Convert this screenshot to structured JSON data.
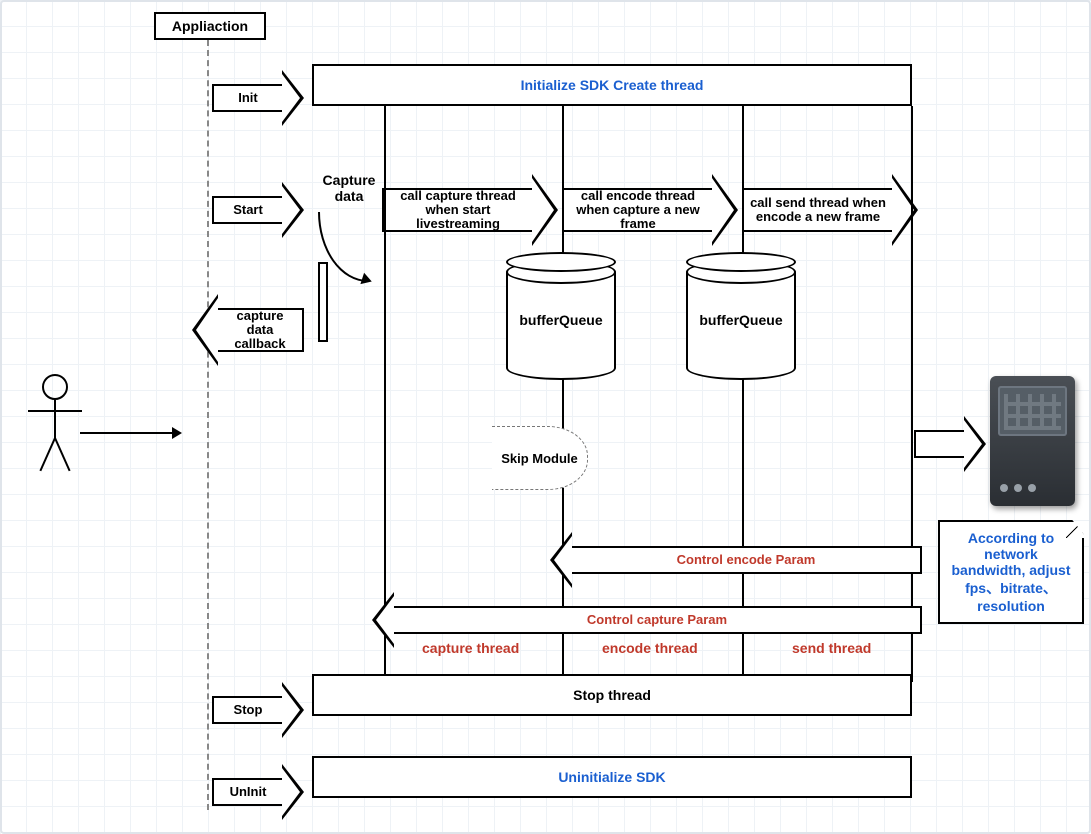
{
  "header": {
    "application": "Appliaction"
  },
  "lifecycle": {
    "init": {
      "label": "Init",
      "bar": "Initialize SDK     Create thread"
    },
    "start": {
      "label": "Start"
    },
    "stop": {
      "label": "Stop",
      "bar": "Stop thread"
    },
    "uninit": {
      "label": "UnInit",
      "bar": "Uninitialize SDK"
    }
  },
  "capture": {
    "data_label": "Capture data",
    "callback_label": "capture data callback"
  },
  "pipeline": {
    "step1": "call capture thread when start livestreaming",
    "step2": "call encode thread when capture a new frame",
    "step3": "call send thread when encode a new frame",
    "buffer_label": "bufferQueue",
    "skip_label": "Skip Module"
  },
  "control": {
    "encode": "Control encode Param",
    "capture": "Control capture Param"
  },
  "threads": {
    "capture": "capture thread",
    "encode": "encode thread",
    "send": "send thread"
  },
  "server_note": "According to network bandwidth, adjust fps、bitrate、resolution"
}
